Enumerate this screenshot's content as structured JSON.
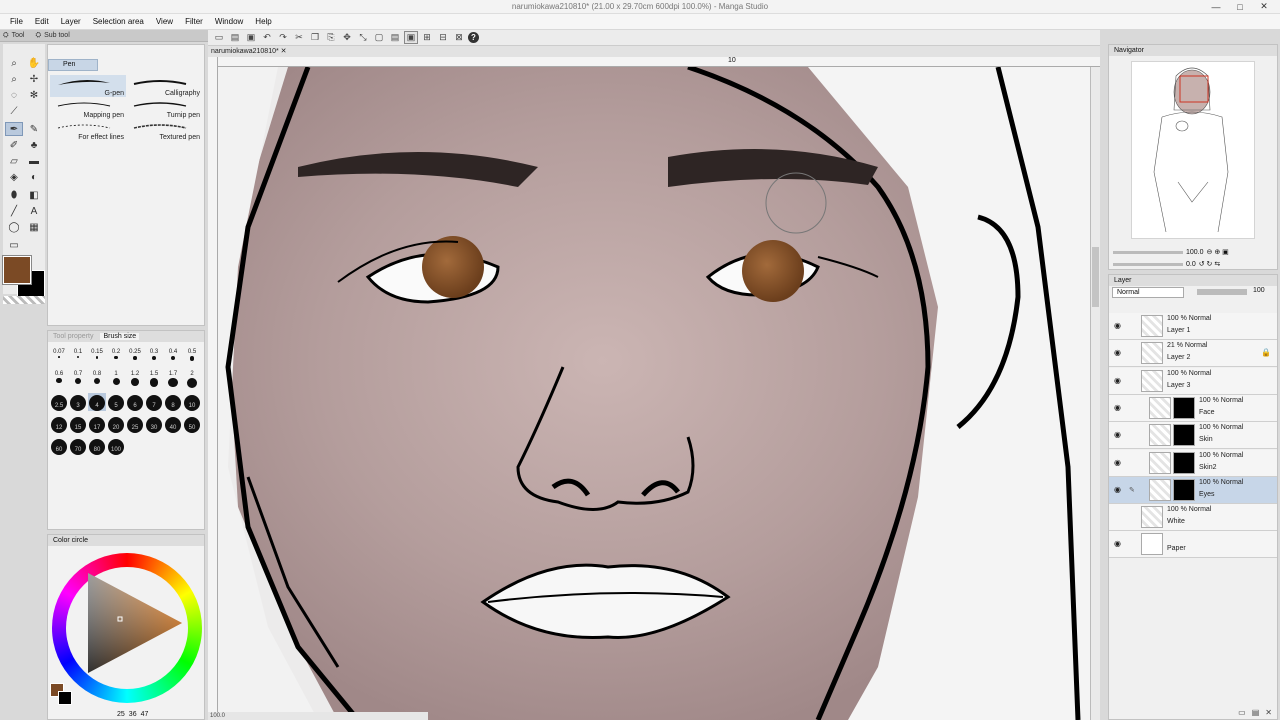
{
  "window": {
    "title": "narumiokawa210810* (21.00 x 29.70cm 600dpi 100.0%) - Manga Studio",
    "controls": [
      "—",
      "□",
      "✕"
    ]
  },
  "menu": [
    "File",
    "Edit",
    "Layer",
    "Selection area",
    "View",
    "Filter",
    "Window",
    "Help"
  ],
  "left": {
    "tool_tab": "Tool",
    "subtool_tab": "Sub tool",
    "pen_group": "Pen",
    "brushes": [
      "G-pen",
      "Calligraphy",
      "Mapping pen",
      "Turnip pen",
      "For effect lines",
      "Textured pen"
    ],
    "brush_size_tab": "Brush size",
    "tool_property_tab": "Tool property",
    "brush_sizes": [
      "0.07",
      "0.1",
      "0.15",
      "0.2",
      "0.25",
      "0.3",
      "0.4",
      "0.5",
      "0.6",
      "0.7",
      "0.8",
      "1",
      "1.2",
      "1.5",
      "1.7",
      "2",
      "2.5",
      "3",
      "4",
      "5",
      "6",
      "7",
      "8",
      "10",
      "12",
      "15",
      "17",
      "20",
      "25",
      "30",
      "40",
      "50",
      "60",
      "70",
      "80",
      "100"
    ],
    "color_tab": "Color circle",
    "color_values": [
      "25",
      "36",
      "47"
    ],
    "colors": {
      "main": "#7b4a25",
      "sub": "#000000"
    }
  },
  "canvas": {
    "doc_tab": "narumiokawa210810*",
    "ruler_mark": "10",
    "status": "100.0"
  },
  "right": {
    "navigator_tab": "Navigator",
    "zoom": "100.0",
    "angle": "0.0",
    "layer_tab": "Layer",
    "blend_mode": "Normal",
    "opacity": "100",
    "layers": [
      {
        "pct": "100 %  Normal",
        "name": "Layer 1",
        "mask": false,
        "lock": false,
        "selected": false,
        "eye": true
      },
      {
        "pct": "21 %  Normal",
        "name": "Layer 2",
        "mask": false,
        "lock": true,
        "selected": false,
        "eye": true
      },
      {
        "pct": "100 %  Normal",
        "name": "Layer 3",
        "mask": false,
        "lock": false,
        "selected": false,
        "eye": true
      },
      {
        "pct": "100 %  Normal",
        "name": "Face",
        "mask": true,
        "lock": false,
        "selected": false,
        "eye": true
      },
      {
        "pct": "100 %  Normal",
        "name": "Skin",
        "mask": true,
        "lock": false,
        "selected": false,
        "eye": true
      },
      {
        "pct": "100 %  Normal",
        "name": "Skin2",
        "mask": true,
        "lock": false,
        "selected": false,
        "eye": true
      },
      {
        "pct": "100 %  Normal",
        "name": "Eyes",
        "mask": true,
        "lock": false,
        "selected": true,
        "eye": true
      },
      {
        "pct": "100 %  Normal",
        "name": "White",
        "mask": false,
        "lock": false,
        "selected": false,
        "eye": false
      },
      {
        "pct": "",
        "name": "Paper",
        "mask": false,
        "lock": false,
        "selected": false,
        "eye": true
      }
    ]
  },
  "icons": [
    "eye-icon",
    "lock-icon",
    "pen-icon",
    "help-icon",
    "undo-icon",
    "redo-icon",
    "new-icon",
    "save-icon",
    "open-icon"
  ]
}
